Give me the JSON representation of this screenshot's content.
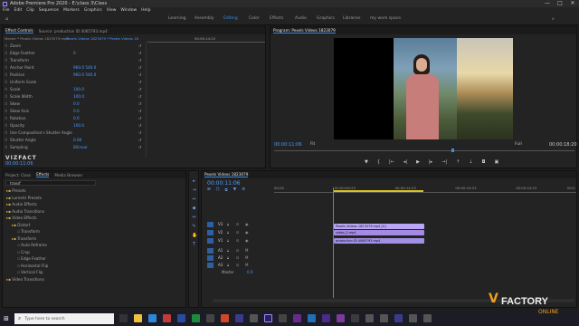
{
  "window": {
    "title": "Adobe Premiere Pro 2020 - E:\\class 3\\Class",
    "minimize": "—",
    "maximize": "□",
    "close": "✕"
  },
  "menu": [
    "File",
    "Edit",
    "Clip",
    "Sequence",
    "Markers",
    "Graphics",
    "View",
    "Window",
    "Help"
  ],
  "workspaces": [
    "Learning",
    "Assembly",
    "Editing",
    "Color",
    "Effects",
    "Audio",
    "Graphics",
    "Libraries",
    "my work space"
  ],
  "active_workspace": "Editing",
  "effect_controls": {
    "tabs": [
      "Effect Controls",
      "Source: production ID 4065793.mp4"
    ],
    "source_label": "Master * Pexels Videos 1823079.mp4",
    "seq_label": "Pexels Videos 1823079 * Pexels Videos 18",
    "ruler_time": "00:00:14:22",
    "rows": [
      {
        "label": "Zoom",
        "value": ""
      },
      {
        "label": "Edge Feather",
        "value": "0"
      },
      {
        "label": "Transform",
        "value": ""
      },
      {
        "label": "Anchor Point",
        "value": "960.0   540.0"
      },
      {
        "label": "Position",
        "value": "960.0   540.0"
      },
      {
        "label": "Uniform Scale",
        "value": ""
      },
      {
        "label": "Scale",
        "value": "100.0"
      },
      {
        "label": "Scale Width",
        "value": "100.0"
      },
      {
        "label": "Skew",
        "value": "0.0"
      },
      {
        "label": "Skew Axis",
        "value": "0.0"
      },
      {
        "label": "Rotation",
        "value": "0.0"
      },
      {
        "label": "Opacity",
        "value": "100.0"
      },
      {
        "label": "Use Composition's Shutter Angle",
        "value": ""
      },
      {
        "label": "Shutter Angle",
        "value": "0.00"
      },
      {
        "label": "Sampling",
        "value": "Bilinear"
      }
    ],
    "current_time": "00:00:11:06",
    "logo": "VIZFACT"
  },
  "program_monitor": {
    "tab": "Program: Pexels Videos 1823079",
    "timecode": "00:00:11:06",
    "fit": "Fit",
    "full": "Full",
    "duration": "00:00:18:20"
  },
  "project_panel": {
    "tabs": [
      "Project: Class",
      "Effects",
      "Media Browser"
    ],
    "search_value": "transf",
    "tree": [
      {
        "label": "Presets",
        "indent": 0
      },
      {
        "label": "Lumetri Presets",
        "indent": 0
      },
      {
        "label": "Audio Effects",
        "indent": 0
      },
      {
        "label": "Audio Transitions",
        "indent": 0
      },
      {
        "label": "Video Effects",
        "indent": 0
      },
      {
        "label": "Distort",
        "indent": 1
      },
      {
        "label": "Transform",
        "indent": 2
      },
      {
        "label": "Transform",
        "indent": 1
      },
      {
        "label": "Auto Reframe",
        "indent": 2
      },
      {
        "label": "Crop",
        "indent": 2
      },
      {
        "label": "Edge Feather",
        "indent": 2
      },
      {
        "label": "Horizontal Flip",
        "indent": 2
      },
      {
        "label": "Vertical Flip",
        "indent": 2
      },
      {
        "label": "Video Transitions",
        "indent": 0
      }
    ]
  },
  "timeline": {
    "tab": "Pexels Videos 1823079",
    "timecode": "00:00:11:06",
    "ruler": [
      "00:00",
      "00:00:09:23",
      "00:00:14:23",
      "00:00:19:23",
      "00:00:24:23",
      "00:0"
    ],
    "tracks": [
      "V3",
      "V2",
      "V1",
      "A1",
      "A2",
      "A3"
    ],
    "master_label": "Master",
    "master_value": "0.0",
    "clips": [
      {
        "label": "Pexels Videos 1823079.mp4 [V]",
        "track": "V3",
        "color": "#b9a6f5"
      },
      {
        "label": "video_2.mp4",
        "track": "V2",
        "color": "#a58ae3"
      },
      {
        "label": "production ID 4065793.mp4",
        "track": "V1",
        "color": "#a190e6"
      }
    ]
  },
  "taskbar": {
    "search_placeholder": "Type here to search",
    "watermark": "FACTORY",
    "watermark_v": "V",
    "watermark_sub": "ONLINE"
  },
  "colors": {
    "accent": "#3a8ee6",
    "clip_v3": "#b9a6f5",
    "clip_v2": "#a58ae3",
    "clip_v1": "#a190e6"
  }
}
